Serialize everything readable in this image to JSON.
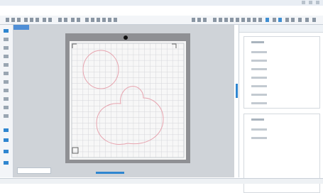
{
  "app": {
    "title": "",
    "menu": []
  },
  "colors": {
    "accent": "#2f86d0",
    "mat_frame": "#8f9094",
    "mat_surface": "#f7f7f7",
    "grid_line": "#d4d6da",
    "cut_line": "#e7a3ae",
    "panel_bg": "#ffffff",
    "toolbar_bg": "#f3f5f8"
  },
  "toolbar": {
    "icons": []
  },
  "left_tools": {
    "icons": []
  },
  "document": {
    "tab_label": "",
    "page_tab_label": ""
  },
  "panel": {
    "title": "",
    "section1": {
      "options": []
    },
    "section2": {
      "options": []
    }
  },
  "status": {
    "text": ""
  }
}
